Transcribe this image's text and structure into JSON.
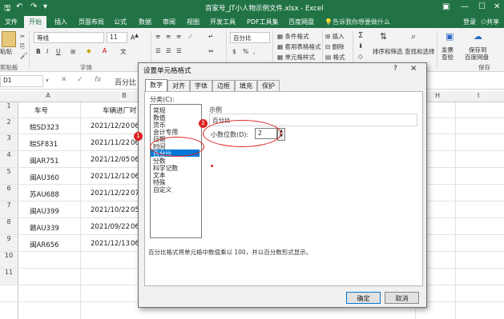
{
  "titlebar": {
    "title": "百家号_JT小人物示例文件.xlsx - Excel",
    "save_icon": "save-icon",
    "undo_icon": "undo-icon",
    "redo_icon": "redo-icon"
  },
  "tabs": [
    "文件",
    "开始",
    "插入",
    "页面布局",
    "公式",
    "数据",
    "审阅",
    "视图",
    "开发工具",
    "PDF工具集",
    "百度网盘"
  ],
  "active_tab": "开始",
  "tell_me": "告诉我你想要做什么",
  "account": {
    "login": "登录",
    "share": "共享"
  },
  "ribbon": {
    "paste": "粘贴",
    "clipboard": "剪贴板",
    "font_name": "等线",
    "font_size": "11",
    "bold": "B",
    "italic": "I",
    "underline": "U",
    "font_group": "字体",
    "number_format": "百分比",
    "percent_sign": "%",
    "conditional_format": "条件格式",
    "table_format": "套用表格格式",
    "cell_style": "单元格样式",
    "insert": "插入",
    "delete": "删除",
    "format": "格式",
    "sort_filter": "排序和筛选",
    "find_select": "查找和选择",
    "invoice_check": "发票查验",
    "save_baidu": "保存到百度网盘",
    "save_baidu_line1": "保存到",
    "save_baidu_line2": "百度网盘",
    "invoice_line1": "发票",
    "invoice_line2": "查验",
    "find_line2": "查找和选择",
    "save_group": "保存"
  },
  "formula_bar": {
    "name_box": "D1",
    "content": "百分比"
  },
  "sheet": {
    "columns": [
      "A",
      "B",
      "C",
      "D",
      "E",
      "F",
      "G",
      "H",
      "I"
    ],
    "rows": [
      "1",
      "2",
      "3",
      "4",
      "5",
      "6",
      "7",
      "8",
      "9",
      "10",
      "11"
    ],
    "header_a": "车号",
    "header_b": "车辆进厂时",
    "col_a": [
      "皖SD323",
      "皖SF831",
      "闽AR751",
      "闽AU360",
      "苏AU688",
      "闽AU399",
      "赣AU339",
      "闽AR656"
    ],
    "col_b": [
      "2021/12/20",
      "2021/11/22",
      "2021/12/05",
      "2021/12/12",
      "2021/12/22",
      "2021/10/22",
      "2021/09/22",
      "2021/12/13"
    ],
    "col_b_tail": [
      "06",
      "06",
      "06",
      "06",
      "07",
      "05",
      "06",
      "06"
    ]
  },
  "dialog": {
    "title": "设置单元格格式",
    "help": "?",
    "close": "×",
    "tabs": [
      "数字",
      "对齐",
      "字体",
      "边框",
      "填充",
      "保护"
    ],
    "category_label": "分类(C):",
    "categories": [
      "常规",
      "数值",
      "货币",
      "会计专用",
      "日期",
      "时间",
      "百分比",
      "分数",
      "科学记数",
      "文本",
      "特殊",
      "自定义"
    ],
    "selected_category": "百分比",
    "sample_label": "示例",
    "sample_value": "百分比",
    "decimals_label": "小数位数(D):",
    "decimals_value": "2",
    "description": "百分比格式将单元格中数值乘以 100，并以百分数形式显示。",
    "ok": "确定",
    "cancel": "取消",
    "marker1": "1",
    "marker2": "2",
    "accent": "#0078d7",
    "marker_color": "#d22222"
  },
  "colors": {
    "excel_green": "#217346"
  }
}
